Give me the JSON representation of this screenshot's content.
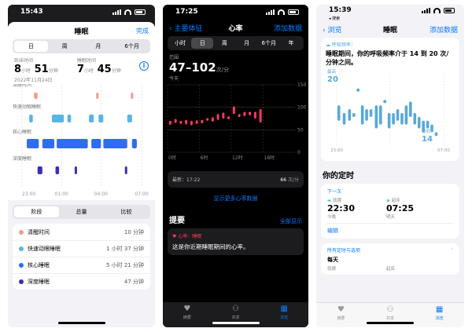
{
  "colors": {
    "accent": "#0a7aff",
    "awake": "#f39c8c",
    "rem": "#5ab4e5",
    "core": "#2f6cf0",
    "deep": "#3a2fb0",
    "heart": "#ff375f",
    "breath": "#57a9d8"
  },
  "p1": {
    "time": "15:43",
    "title": "睡眠",
    "done": "完成",
    "tabs": [
      "日",
      "周",
      "月",
      "6个月"
    ],
    "in_bed_label": "卧床时间",
    "in_bed_h": "8",
    "in_bed_min": "51",
    "asleep_label": "睡眠时间",
    "asleep_h": "7",
    "asleep_min": "45",
    "unit_h": "小时",
    "unit_min": "分钟",
    "date": "2022年11月24日",
    "row_labels": [
      "清醒时间",
      "快速动眼睡眠",
      "核心睡眠",
      "深度睡眠"
    ],
    "x_ticks": [
      "23:00",
      "01:00",
      "04:00",
      "07:00"
    ],
    "tabs2": [
      "阶段",
      "总量",
      "比较"
    ],
    "stages": [
      {
        "label": "清醒时间",
        "value": "10 分钟",
        "color": "#f39c8c"
      },
      {
        "label": "快速动眼睡眠",
        "value": "1 小时 37 分钟",
        "color": "#5ab4e5"
      },
      {
        "label": "核心睡眠",
        "value": "5 小时 21 分钟",
        "color": "#2f6cf0"
      },
      {
        "label": "深度睡眠",
        "value": "47 分钟",
        "color": "#3a2fb0"
      }
    ]
  },
  "p2": {
    "time": "17:25",
    "back": "主要体征",
    "title": "心率",
    "add": "添加数据",
    "tabs": [
      "小时",
      "日",
      "周",
      "月",
      "6个月",
      "年"
    ],
    "range_label": "范围",
    "range_value": "47–102",
    "range_unit": "次/分",
    "period": "今天",
    "latest_label": "最新：17:22",
    "latest_value": "66",
    "latest_unit": "次/分",
    "more": "显示更多心率数据",
    "highlights": "提要",
    "show_all": "全部显示",
    "hl_tag": "心率：睡眠",
    "hl_text": "这是你近期睡眠期间的心率。",
    "tab_summary": "摘要",
    "tab_sharing": "共享",
    "tab_browse": "浏览"
  },
  "p3": {
    "time": "15:39",
    "status_sub": "搜索",
    "back": "浏览",
    "title": "睡眠",
    "add": "添加数据",
    "resp_tag": "呼吸频率：",
    "resp_text": "睡眠期间，你的呼吸频率介于 14 到 20 次/分钟之间。",
    "hi_label": "最高",
    "hi_value": "20",
    "lo_label": "最低",
    "lo_value": "14",
    "x_start": "23:00",
    "x_end": "07:00",
    "schedule_title": "你的定时",
    "next": "下一次",
    "bedtime_label": "就寝",
    "bedtime": "22:30",
    "bedtime_day": "今晚",
    "wake_label": "起床",
    "wake": "07:25",
    "wake_day": "明天",
    "edit": "编辑",
    "all_schedules": "所有定时与选项",
    "every_day": "每天",
    "bedtime_label2": "就寝",
    "wake_label2": "起床",
    "tab_summary": "摘要",
    "tab_sharing": "共享",
    "tab_browse": "浏览"
  },
  "chart_data": [
    {
      "type": "bar",
      "title": "",
      "categories": [
        "清醒时间",
        "快速动眼睡眠",
        "核心睡眠",
        "深度睡眠"
      ],
      "x": [
        "23:00",
        "01:00",
        "04:00",
        "07:00"
      ],
      "segments": [
        {
          "stage": 0,
          "start": 0.1,
          "end": 0.13
        },
        {
          "stage": 0,
          "start": 0.62,
          "end": 0.64
        },
        {
          "stage": 0,
          "start": 0.91,
          "end": 0.93
        },
        {
          "stage": 1,
          "start": 0.06,
          "end": 0.09
        },
        {
          "stage": 1,
          "start": 0.25,
          "end": 0.35
        },
        {
          "stage": 1,
          "start": 0.38,
          "end": 0.41
        },
        {
          "stage": 1,
          "start": 0.56,
          "end": 0.6
        },
        {
          "stage": 1,
          "start": 0.64,
          "end": 0.68
        },
        {
          "stage": 1,
          "start": 0.88,
          "end": 0.92
        },
        {
          "stage": 2,
          "start": 0.04,
          "end": 0.14
        },
        {
          "stage": 2,
          "start": 0.17,
          "end": 0.27
        },
        {
          "stage": 2,
          "start": 0.29,
          "end": 0.55
        },
        {
          "stage": 2,
          "start": 0.58,
          "end": 0.66
        },
        {
          "stage": 2,
          "start": 0.68,
          "end": 0.88
        },
        {
          "stage": 2,
          "start": 0.92,
          "end": 0.96
        },
        {
          "stage": 3,
          "start": 0.13,
          "end": 0.17
        },
        {
          "stage": 3,
          "start": 0.28,
          "end": 0.31
        },
        {
          "stage": 3,
          "start": 0.44,
          "end": 0.46
        },
        {
          "stage": 3,
          "start": 0.86,
          "end": 0.88
        }
      ]
    },
    {
      "type": "bar",
      "title": "",
      "x": [
        "0时",
        "6时",
        "12时",
        "18时"
      ],
      "ylim": [
        0,
        150
      ],
      "yticks": [
        150,
        100,
        50,
        0
      ],
      "ranges": [
        {
          "hour": 0.5,
          "low": 61,
          "high": 70
        },
        {
          "hour": 1.5,
          "low": 65,
          "high": 74
        },
        {
          "hour": 2.5,
          "low": 63,
          "high": 70
        },
        {
          "hour": 3.5,
          "low": 62,
          "high": 72
        },
        {
          "hour": 4.5,
          "low": 60,
          "high": 70
        },
        {
          "hour": 5.5,
          "low": 63,
          "high": 71
        },
        {
          "hour": 6.5,
          "low": 64,
          "high": 72
        },
        {
          "hour": 7.5,
          "low": 70,
          "high": 76
        },
        {
          "hour": 8.5,
          "low": 68,
          "high": 78
        },
        {
          "hour": 9.5,
          "low": 72,
          "high": 85
        },
        {
          "hour": 10.5,
          "low": 75,
          "high": 88
        },
        {
          "hour": 11.5,
          "low": 73,
          "high": 80
        },
        {
          "hour": 12.5,
          "low": 85,
          "high": 102
        },
        {
          "hour": 13.5,
          "low": 78,
          "high": 85
        },
        {
          "hour": 14.5,
          "low": 80,
          "high": 90
        },
        {
          "hour": 15.5,
          "low": 82,
          "high": 90
        },
        {
          "hour": 16.5,
          "low": 75,
          "high": 90
        },
        {
          "hour": 17.5,
          "low": 66,
          "high": 96
        }
      ]
    },
    {
      "type": "scatter",
      "title": "",
      "x": [
        "23:00",
        "07:00"
      ],
      "ylim": [
        13,
        21
      ],
      "points": [
        {
          "t": 0.02,
          "low": 16,
          "high": 18
        },
        {
          "t": 0.07,
          "low": 15.5,
          "high": 17
        },
        {
          "t": 0.12,
          "low": 16,
          "high": 17.5
        },
        {
          "t": 0.16,
          "low": 16.5,
          "high": 17
        },
        {
          "t": 0.2,
          "low": 20,
          "high": 20
        },
        {
          "t": 0.24,
          "low": 15.5,
          "high": 18
        },
        {
          "t": 0.28,
          "low": 16,
          "high": 17.5
        },
        {
          "t": 0.32,
          "low": 16.5,
          "high": 17.5
        },
        {
          "t": 0.37,
          "low": 15,
          "high": 18
        },
        {
          "t": 0.41,
          "low": 15.5,
          "high": 18
        },
        {
          "t": 0.45,
          "low": 18.5,
          "high": 18.5
        },
        {
          "t": 0.49,
          "low": 15,
          "high": 17
        },
        {
          "t": 0.53,
          "low": 15.5,
          "high": 17
        },
        {
          "t": 0.57,
          "low": 16,
          "high": 17.5
        },
        {
          "t": 0.61,
          "low": 15.5,
          "high": 17
        },
        {
          "t": 0.65,
          "low": 15.5,
          "high": 18
        },
        {
          "t": 0.69,
          "low": 16.5,
          "high": 18.5
        },
        {
          "t": 0.73,
          "low": 15.5,
          "high": 17
        },
        {
          "t": 0.77,
          "low": 15,
          "high": 16.5
        },
        {
          "t": 0.81,
          "low": 14.5,
          "high": 16
        },
        {
          "t": 0.85,
          "low": 15,
          "high": 16
        },
        {
          "t": 0.89,
          "low": 14.5,
          "high": 15.5
        },
        {
          "t": 0.93,
          "low": 14,
          "high": 14.5
        }
      ]
    }
  ]
}
